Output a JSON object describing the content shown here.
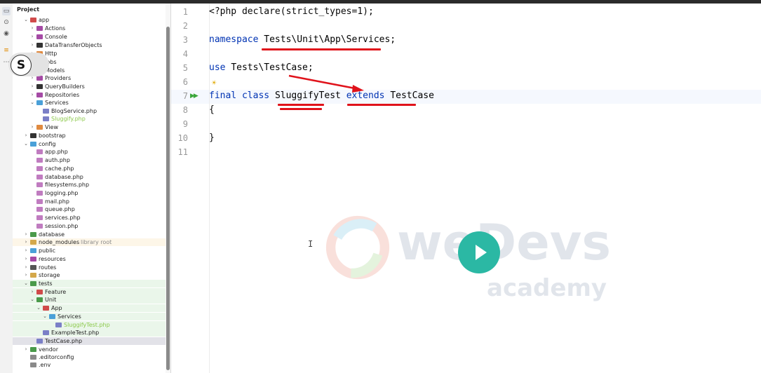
{
  "project_panel": {
    "title": "Project",
    "items": [
      {
        "label": "app",
        "type": "folder",
        "state": "open",
        "hint": ""
      },
      {
        "label": "Actions",
        "type": "folder",
        "state": "closed",
        "hint": ""
      },
      {
        "label": "Console",
        "type": "folder",
        "state": "closed",
        "hint": ""
      },
      {
        "label": "DataTransferObjects",
        "type": "folder",
        "state": "closed",
        "hint": ""
      },
      {
        "label": "Http",
        "type": "folder",
        "state": "closed",
        "hint": ""
      },
      {
        "label": "Jobs",
        "type": "folder",
        "state": "closed",
        "hint": ""
      },
      {
        "label": "Models",
        "type": "folder",
        "state": "closed",
        "hint": ""
      },
      {
        "label": "Providers",
        "type": "folder",
        "state": "closed",
        "hint": ""
      },
      {
        "label": "QueryBuilders",
        "type": "folder",
        "state": "closed",
        "hint": ""
      },
      {
        "label": "Repositories",
        "type": "folder",
        "state": "closed",
        "hint": ""
      },
      {
        "label": "Services",
        "type": "folder",
        "state": "open",
        "hint": ""
      },
      {
        "label": "BlogService.php",
        "type": "php",
        "state": "",
        "hint": ""
      },
      {
        "label": "Sluggify.php",
        "type": "php-new",
        "state": "",
        "hint": ""
      },
      {
        "label": "View",
        "type": "folder",
        "state": "closed",
        "hint": ""
      },
      {
        "label": "bootstrap",
        "type": "folder",
        "state": "closed",
        "hint": ""
      },
      {
        "label": "config",
        "type": "folder",
        "state": "open",
        "hint": ""
      },
      {
        "label": "app.php",
        "type": "config",
        "state": "",
        "hint": ""
      },
      {
        "label": "auth.php",
        "type": "config",
        "state": "",
        "hint": ""
      },
      {
        "label": "cache.php",
        "type": "config",
        "state": "",
        "hint": ""
      },
      {
        "label": "database.php",
        "type": "config",
        "state": "",
        "hint": ""
      },
      {
        "label": "filesystems.php",
        "type": "config",
        "state": "",
        "hint": ""
      },
      {
        "label": "logging.php",
        "type": "config",
        "state": "",
        "hint": ""
      },
      {
        "label": "mail.php",
        "type": "config",
        "state": "",
        "hint": ""
      },
      {
        "label": "queue.php",
        "type": "config",
        "state": "",
        "hint": ""
      },
      {
        "label": "services.php",
        "type": "config",
        "state": "",
        "hint": ""
      },
      {
        "label": "session.php",
        "type": "config",
        "state": "",
        "hint": ""
      },
      {
        "label": "database",
        "type": "folder",
        "state": "closed",
        "hint": ""
      },
      {
        "label": "node_modules",
        "type": "folder",
        "state": "closed",
        "hint": "library root"
      },
      {
        "label": "public",
        "type": "folder",
        "state": "closed",
        "hint": ""
      },
      {
        "label": "resources",
        "type": "folder",
        "state": "closed",
        "hint": ""
      },
      {
        "label": "routes",
        "type": "folder",
        "state": "closed",
        "hint": ""
      },
      {
        "label": "storage",
        "type": "folder",
        "state": "closed",
        "hint": ""
      },
      {
        "label": "tests",
        "type": "folder",
        "state": "open",
        "hint": ""
      },
      {
        "label": "Feature",
        "type": "folder",
        "state": "closed",
        "hint": ""
      },
      {
        "label": "Unit",
        "type": "folder",
        "state": "open",
        "hint": ""
      },
      {
        "label": "App",
        "type": "folder",
        "state": "open",
        "hint": ""
      },
      {
        "label": "Services",
        "type": "folder",
        "state": "open",
        "hint": ""
      },
      {
        "label": "SluggifyTest.php",
        "type": "php-new",
        "state": "",
        "hint": ""
      },
      {
        "label": "ExampleTest.php",
        "type": "php",
        "state": "",
        "hint": ""
      },
      {
        "label": "TestCase.php",
        "type": "php",
        "state": "",
        "hint": ""
      },
      {
        "label": "vendor",
        "type": "folder",
        "state": "closed",
        "hint": ""
      },
      {
        "label": ".editorconfig",
        "type": "file",
        "state": "",
        "hint": ""
      },
      {
        "label": ".env",
        "type": "file",
        "state": "",
        "hint": ""
      }
    ]
  },
  "overlay": {
    "letter": "S"
  },
  "editor": {
    "line_numbers": [
      "1",
      "2",
      "3",
      "4",
      "5",
      "6",
      "7",
      "8",
      "9",
      "10",
      "11"
    ],
    "lines": {
      "l1": {
        "t1": "<?php declare(strict_types=1);"
      },
      "l3": {
        "kw": "namespace",
        "rest": "Tests\\Unit\\App\\Services;"
      },
      "l5": {
        "kw": "use",
        "rest": "Tests\\TestCase;"
      },
      "l7": {
        "kw1": "final",
        "kw2": "class",
        "name": "SluggifyTest",
        "kw3": "extends",
        "parent": "TestCase"
      },
      "l8": {
        "t1": "{"
      },
      "l10": {
        "t1": "}"
      }
    },
    "run_marker": "▶▶",
    "intention_marker": "☀",
    "cursor": "I"
  },
  "watermark": {
    "line1": "weDevs",
    "line2": "academy"
  },
  "colors": {
    "accent_play": "#2bb8a4",
    "annotation_red": "#e0131b",
    "keyword": "#0033b3"
  },
  "icons": {
    "toolstrip": [
      "project-icon",
      "commit-icon",
      "github-icon",
      "structure-icon",
      "more-icon"
    ]
  }
}
